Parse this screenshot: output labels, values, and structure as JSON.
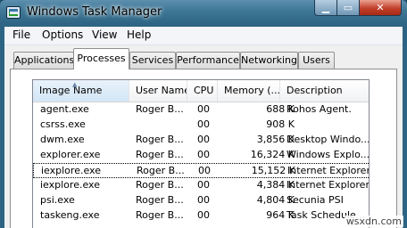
{
  "window": {
    "title": "Windows Task Manager",
    "close_glyph": "✕",
    "min_glyph": "▁",
    "max_glyph": "▭"
  },
  "menubar": {
    "items": [
      {
        "label": "File"
      },
      {
        "label": "Options"
      },
      {
        "label": "View"
      },
      {
        "label": "Help"
      }
    ]
  },
  "tabs": [
    {
      "label": "Applications",
      "active": false
    },
    {
      "label": "Processes",
      "active": true
    },
    {
      "label": "Services",
      "active": false
    },
    {
      "label": "Performance",
      "active": false
    },
    {
      "label": "Networking",
      "active": false
    },
    {
      "label": "Users",
      "active": false
    }
  ],
  "process_list": {
    "columns": [
      "Image Name",
      "User Name",
      "CPU",
      "Memory (...",
      "Description"
    ],
    "sorted_column": "Image Name",
    "rows": [
      {
        "image": "agent.exe",
        "user": "Roger B...",
        "cpu": "00",
        "memory": "688 K",
        "description": "Rohos Agent."
      },
      {
        "image": "csrss.exe",
        "user": "",
        "cpu": "00",
        "memory": "908 K",
        "description": ""
      },
      {
        "image": "dwm.exe",
        "user": "Roger B...",
        "cpu": "00",
        "memory": "3,856 K",
        "description": "Desktop Windo..."
      },
      {
        "image": "explorer.exe",
        "user": "Roger B...",
        "cpu": "00",
        "memory": "16,324 K",
        "description": "Windows Explo..."
      },
      {
        "image": "iexplore.exe",
        "user": "Roger B...",
        "cpu": "00",
        "memory": "15,152 K",
        "description": "Internet Explorer",
        "selected": true
      },
      {
        "image": "iexplore.exe",
        "user": "Roger B...",
        "cpu": "00",
        "memory": "4,384 K",
        "description": "Internet Explorer"
      },
      {
        "image": "psi.exe",
        "user": "Roger B...",
        "cpu": "00",
        "memory": "4,804 K",
        "description": "Secunia PSI"
      },
      {
        "image": "taskeng.exe",
        "user": "Roger B...",
        "cpu": "00",
        "memory": "964 K",
        "description": "Task Schedule..."
      }
    ]
  },
  "watermark": "wsxdn.com",
  "colors": {
    "title_bar": "#2f6685",
    "close_button": "#c0402a",
    "selection_border": "#000000"
  },
  "icons": {
    "app": "task-manager-icon",
    "sort": "sort-ascending-icon"
  }
}
